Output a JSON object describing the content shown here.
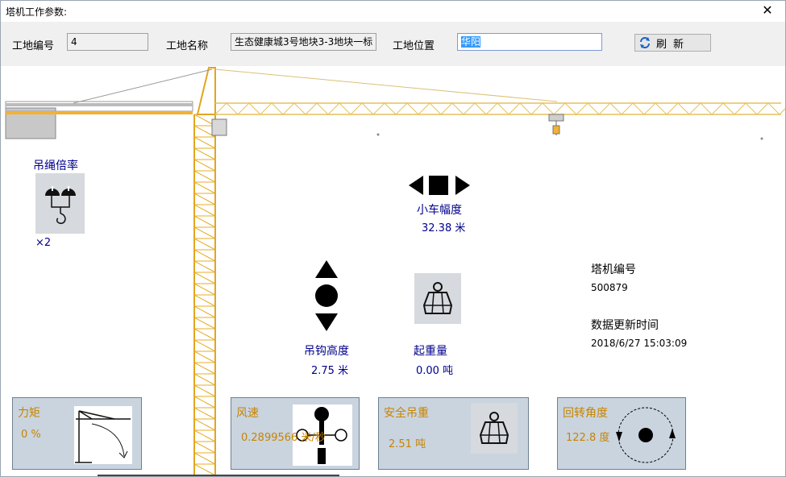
{
  "window": {
    "title": "塔机工作参数:",
    "close_glyph": "✕"
  },
  "header": {
    "site_no_label": "工地编号",
    "site_no_value": "4",
    "site_name_label": "工地名称",
    "site_name_value": "生态健康城3号地块3-3地块一标",
    "site_loc_label": "工地位置",
    "site_loc_value": "华阳",
    "refresh_label": "刷新"
  },
  "rope": {
    "label": "吊绳倍率",
    "value": "×2"
  },
  "trolley": {
    "label": "小车幅度",
    "value": "32.38 米"
  },
  "hook": {
    "label": "吊钩高度",
    "value": "2.75 米"
  },
  "load": {
    "label": "起重量",
    "value": "0.00 吨"
  },
  "crane_info": {
    "id_label": "塔机编号",
    "id_value": "500879",
    "time_label": "数据更新时间",
    "time_value": "2018/6/27 15:03:09"
  },
  "tiles": {
    "moment": {
      "label": "力矩",
      "value": "0 %"
    },
    "wind": {
      "label": "风速",
      "value": "0.2899566 米/秒"
    },
    "safe_load": {
      "label": "安全吊重",
      "value": "2.51 吨"
    },
    "rotation": {
      "label": "回转角度",
      "value": "122.8 度"
    }
  },
  "colors": {
    "crane_yellow": "#f2b233",
    "accent_blue": "#00008b",
    "value_orange": "#c88400",
    "tile_bg": "#c9d4df"
  },
  "icons": [
    "close-icon",
    "refresh-icon",
    "crane-image",
    "pulley-hook-icon",
    "left-arrow-icon",
    "right-arrow-icon",
    "up-arrow-icon",
    "down-arrow-icon",
    "weight-icon",
    "moment-curve-icon",
    "wind-gauge-icon",
    "rotation-icon"
  ]
}
